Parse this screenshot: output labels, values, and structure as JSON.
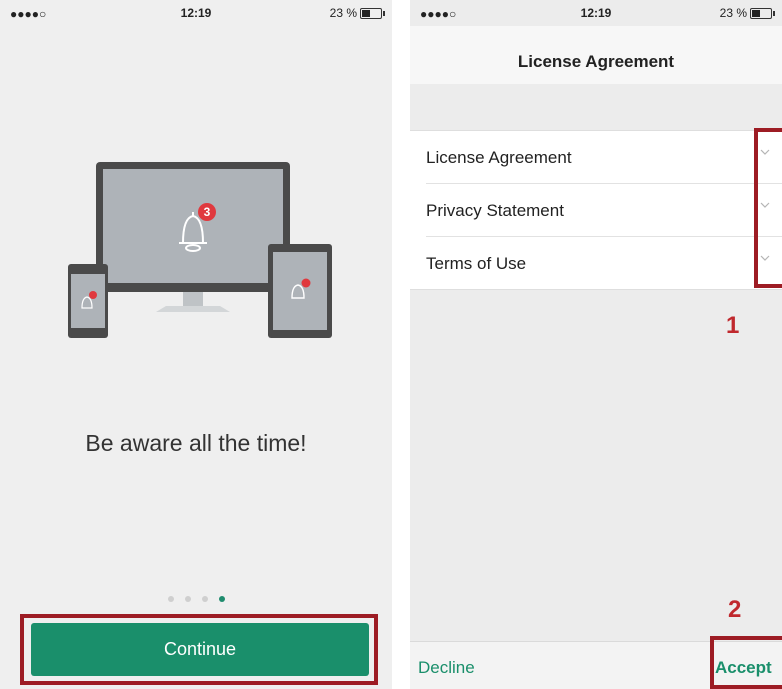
{
  "status_bar": {
    "signal": "●●●●○",
    "time": "12:19",
    "battery": "23 %"
  },
  "onboarding": {
    "slogan": "Be aware all the time!",
    "badge_count": "3",
    "continue_label": "Continue",
    "page_count": 4,
    "active_page": 4
  },
  "license": {
    "title": "License Agreement",
    "items": [
      {
        "label": "License Agreement"
      },
      {
        "label": "Privacy Statement"
      },
      {
        "label": "Terms of Use"
      }
    ],
    "decline_label": "Decline",
    "accept_label": "Accept"
  },
  "annotations": {
    "marker_1": "1",
    "marker_2": "2"
  },
  "colors": {
    "accent": "#1a8f6b",
    "highlight": "#9d1c24",
    "marker": "#c0282d",
    "badge": "#e0393e"
  }
}
